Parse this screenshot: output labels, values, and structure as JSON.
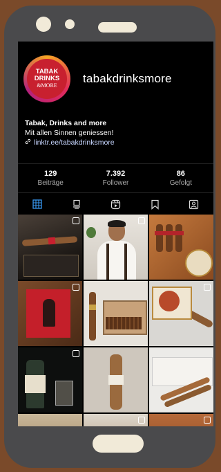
{
  "profile": {
    "username": "tabakdrinksmore",
    "avatar": {
      "line1": "TABAK",
      "line2": "DRINKS",
      "line3": "&MORE"
    },
    "display_name": "Tabak, Drinks and more",
    "tagline": "Mit allen Sinnen geniessen!",
    "link": "linktr.ee/tabakdrinksmore"
  },
  "stats": [
    {
      "value": "129",
      "label": "Beiträge"
    },
    {
      "value": "7.392",
      "label": "Follower"
    },
    {
      "value": "86",
      "label": "Gefolgt"
    }
  ],
  "tabs": [
    {
      "icon": "grid-icon",
      "active": true
    },
    {
      "icon": "feed-icon",
      "active": false
    },
    {
      "icon": "reels-icon",
      "active": false
    },
    {
      "icon": "bookmark-icon",
      "active": false
    },
    {
      "icon": "tagged-icon",
      "active": false
    }
  ],
  "colors": {
    "accent": "#3897f0",
    "frame": "#4a4a4c",
    "background": "#7a4a2a",
    "avatar": "#c8202f"
  }
}
